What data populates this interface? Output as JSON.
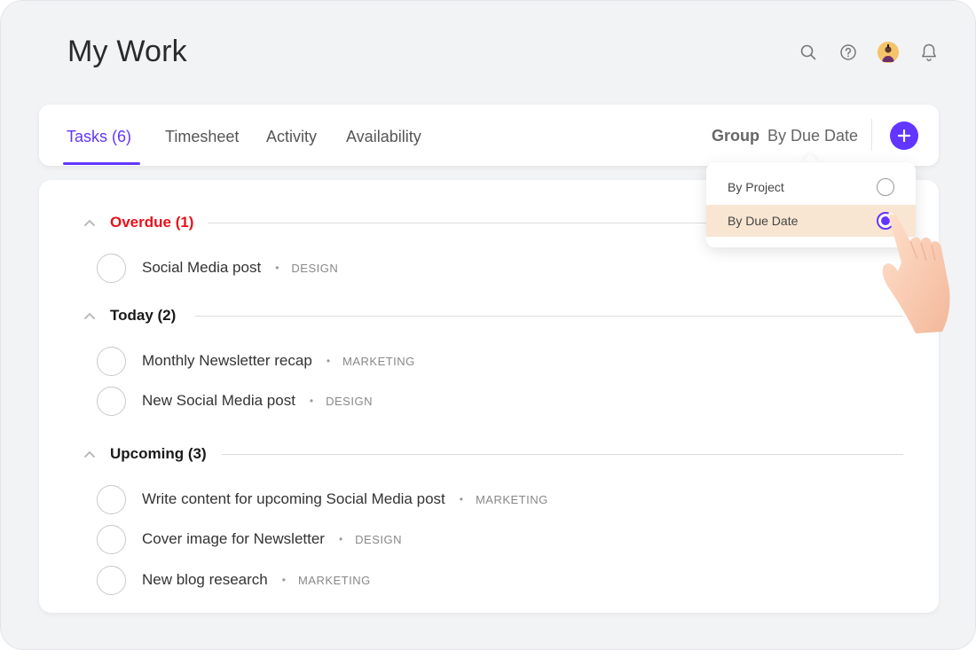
{
  "page": {
    "title": "My Work"
  },
  "header_icons": [
    "search-icon",
    "help-icon",
    "avatar",
    "bell-icon"
  ],
  "tabs": [
    {
      "label": "Tasks (6)",
      "active": true
    },
    {
      "label": "Timesheet",
      "active": false
    },
    {
      "label": "Activity",
      "active": false
    },
    {
      "label": "Availability",
      "active": false
    }
  ],
  "group": {
    "label": "Group",
    "value": "By Due Date"
  },
  "dropdown": {
    "options": [
      {
        "label": "By Project",
        "selected": false
      },
      {
        "label": "By Due Date",
        "selected": true
      }
    ]
  },
  "sections": [
    {
      "title": "Overdue (1)",
      "tasks": [
        {
          "name": "Social Media post",
          "tag": "DESIGN"
        }
      ]
    },
    {
      "title": "Today (2)",
      "tasks": [
        {
          "name": "Monthly Newsletter recap",
          "tag": "MARKETING"
        },
        {
          "name": "New Social Media post",
          "tag": "DESIGN"
        }
      ]
    },
    {
      "title": "Upcoming (3)",
      "tasks": [
        {
          "name": "Write content for upcoming Social Media post",
          "tag": "MARKETING"
        },
        {
          "name": "Cover image for Newsletter",
          "tag": "DESIGN"
        },
        {
          "name": "New blog research",
          "tag": "MARKETING"
        }
      ]
    }
  ],
  "colors": {
    "accent": "#6236ff",
    "overdue": "#e8121b",
    "selected_bg": "#f8e6d2"
  }
}
